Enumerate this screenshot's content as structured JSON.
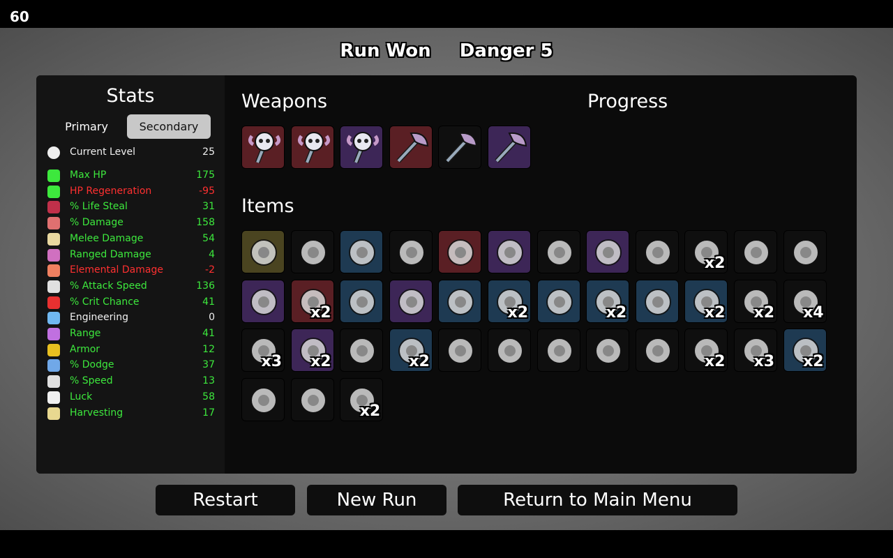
{
  "fps": "60",
  "header": {
    "result": "Run Won",
    "danger": "Danger 5"
  },
  "stats_panel": {
    "title": "Stats",
    "tab_primary": "Primary",
    "tab_secondary": "Secondary",
    "current_level": {
      "label": "Current Level",
      "value": "25"
    },
    "rows": [
      {
        "label": "Max HP",
        "value": "175",
        "color": "g",
        "icon": "heart-icon",
        "icon_color": "#3de83d"
      },
      {
        "label": "HP Regeneration",
        "value": "-95",
        "color": "r",
        "icon": "heart-plus-icon",
        "icon_color": "#3de83d"
      },
      {
        "label": "% Life Steal",
        "value": "31",
        "color": "g",
        "icon": "fangs-icon",
        "icon_color": "#c0304a"
      },
      {
        "label": "% Damage",
        "value": "158",
        "color": "g",
        "icon": "muscle-icon",
        "icon_color": "#e07070"
      },
      {
        "label": "Melee Damage",
        "value": "54",
        "color": "g",
        "icon": "sword-icon",
        "icon_color": "#e8d8a0"
      },
      {
        "label": "Ranged Damage",
        "value": "4",
        "color": "g",
        "icon": "bow-icon",
        "icon_color": "#d070c0"
      },
      {
        "label": "Elemental Damage",
        "value": "-2",
        "color": "r",
        "icon": "flame-icon",
        "icon_color": "#f08060"
      },
      {
        "label": "% Attack Speed",
        "value": "136",
        "color": "g",
        "icon": "hourglass-icon",
        "icon_color": "#e0e0e0"
      },
      {
        "label": "% Crit Chance",
        "value": "41",
        "color": "g",
        "icon": "crit-burst-icon",
        "icon_color": "#e83030"
      },
      {
        "label": "Engineering",
        "value": "0",
        "color": "w",
        "icon": "wrench-icon",
        "icon_color": "#70b8f0"
      },
      {
        "label": "Range",
        "value": "41",
        "color": "g",
        "icon": "range-wave-icon",
        "icon_color": "#c070e0"
      },
      {
        "label": "Armor",
        "value": "12",
        "color": "g",
        "icon": "shield-icon",
        "icon_color": "#e8c020"
      },
      {
        "label": "% Dodge",
        "value": "37",
        "color": "g",
        "icon": "dodge-icon",
        "icon_color": "#70a8e8"
      },
      {
        "label": "% Speed",
        "value": "13",
        "color": "g",
        "icon": "boot-icon",
        "icon_color": "#e0e0e0"
      },
      {
        "label": "Luck",
        "value": "58",
        "color": "g",
        "icon": "dice-icon",
        "icon_color": "#f0f0f0"
      },
      {
        "label": "Harvesting",
        "value": "17",
        "color": "g",
        "icon": "wheat-icon",
        "icon_color": "#e8d890"
      }
    ]
  },
  "weapons": {
    "title": "Weapons",
    "list": [
      {
        "icon": "bone-mace-icon",
        "tier_color": "#5a1f24"
      },
      {
        "icon": "bone-mace-icon",
        "tier_color": "#5a1f24"
      },
      {
        "icon": "bone-mace-icon",
        "tier_color": "#3d2657"
      },
      {
        "icon": "axe-icon",
        "tier_color": "#5a1f24"
      },
      {
        "icon": "axe-icon",
        "tier_color": "#0f0f0f"
      },
      {
        "icon": "axe-icon",
        "tier_color": "#3d2657"
      }
    ]
  },
  "progress": {
    "title": "Progress"
  },
  "items": {
    "title": "Items",
    "list": [
      {
        "icon": "egg-face-icon",
        "tier_color": "#4a4420",
        "qty": ""
      },
      {
        "icon": "rubber-duck-icon",
        "tier_color": "#0f0f0f",
        "qty": ""
      },
      {
        "icon": "worm-icon",
        "tier_color": "#1e3a52",
        "qty": ""
      },
      {
        "icon": "glowing-eyes-icon",
        "tier_color": "#0f0f0f",
        "qty": ""
      },
      {
        "icon": "belt-icon",
        "tier_color": "#5a1f24",
        "qty": ""
      },
      {
        "icon": "potion-machine-icon",
        "tier_color": "#3d2657",
        "qty": ""
      },
      {
        "icon": "cat-statue-icon",
        "tier_color": "#0f0f0f",
        "qty": ""
      },
      {
        "icon": "brain-icon",
        "tier_color": "#3d2657",
        "qty": ""
      },
      {
        "icon": "tooth-icon",
        "tier_color": "#0f0f0f",
        "qty": ""
      },
      {
        "icon": "map-scroll-icon",
        "tier_color": "#0f0f0f",
        "qty": "x2"
      },
      {
        "icon": "crescent-icon",
        "tier_color": "#0f0f0f",
        "qty": ""
      },
      {
        "icon": "thorn-icon",
        "tier_color": "#0f0f0f",
        "qty": ""
      },
      {
        "icon": "peacock-icon",
        "tier_color": "#3d2657",
        "qty": ""
      },
      {
        "icon": "mammoth-icon",
        "tier_color": "#5a1f24",
        "qty": "x2"
      },
      {
        "icon": "glove-icon",
        "tier_color": "#1e3a52",
        "qty": ""
      },
      {
        "icon": "baby-bottle-icon",
        "tier_color": "#3d2657",
        "qty": ""
      },
      {
        "icon": "dead-rat-icon",
        "tier_color": "#1e3a52",
        "qty": ""
      },
      {
        "icon": "cape-icon",
        "tier_color": "#1e3a52",
        "qty": "x2"
      },
      {
        "icon": "helmet-visor-icon",
        "tier_color": "#1e3a52",
        "qty": ""
      },
      {
        "icon": "stone-icon",
        "tier_color": "#1e3a52",
        "qty": "x2"
      },
      {
        "icon": "machine-icon",
        "tier_color": "#1e3a52",
        "qty": ""
      },
      {
        "icon": "claw-horn-icon",
        "tier_color": "#1e3a52",
        "qty": "x2"
      },
      {
        "icon": "snowball-icon",
        "tier_color": "#0f0f0f",
        "qty": "x2"
      },
      {
        "icon": "spider-icon",
        "tier_color": "#0f0f0f",
        "qty": "x4"
      },
      {
        "icon": "bandage-icon",
        "tier_color": "#0f0f0f",
        "qty": "x3"
      },
      {
        "icon": "bunny-icon",
        "tier_color": "#3d2657",
        "qty": "x2"
      },
      {
        "icon": "rocket-icon",
        "tier_color": "#0f0f0f",
        "qty": ""
      },
      {
        "icon": "green-potion-icon",
        "tier_color": "#1e3a52",
        "qty": "x2"
      },
      {
        "icon": "coffee-cup-icon",
        "tier_color": "#0f0f0f",
        "qty": ""
      },
      {
        "icon": "butterfly-icon",
        "tier_color": "#0f0f0f",
        "qty": ""
      },
      {
        "icon": "lizard-icon",
        "tier_color": "#0f0f0f",
        "qty": ""
      },
      {
        "icon": "bear-icon",
        "tier_color": "#0f0f0f",
        "qty": ""
      },
      {
        "icon": "slime-icon",
        "tier_color": "#0f0f0f",
        "qty": ""
      },
      {
        "icon": "alien-icon",
        "tier_color": "#0f0f0f",
        "qty": "x2"
      },
      {
        "icon": "scythe-icon",
        "tier_color": "#0f0f0f",
        "qty": "x3"
      },
      {
        "icon": "flask-icon",
        "tier_color": "#1e3a52",
        "qty": "x2"
      },
      {
        "icon": "steel-helmet-icon",
        "tier_color": "#0f0f0f",
        "qty": ""
      },
      {
        "icon": "syringe-icon",
        "tier_color": "#0f0f0f",
        "qty": ""
      },
      {
        "icon": "skull-icon",
        "tier_color": "#0f0f0f",
        "qty": "x2"
      }
    ]
  },
  "buttons": {
    "restart": "Restart",
    "new_run": "New Run",
    "main_menu": "Return to Main Menu"
  }
}
